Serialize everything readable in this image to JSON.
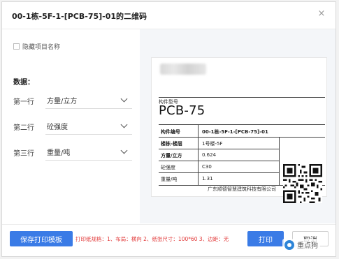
{
  "dialog": {
    "title": "00-1栋-5F-1-[PCB-75]-01的二维码",
    "close_icon": "×"
  },
  "options": {
    "hide_name_label": "隐藏项目名称",
    "hide_name_checked": false
  },
  "data_section": {
    "label": "数据：",
    "rows": [
      {
        "label": "第一行",
        "value": "方量/立方"
      },
      {
        "label": "第二行",
        "value": "砼强度"
      },
      {
        "label": "第三行",
        "value": "重量/吨"
      }
    ]
  },
  "preview": {
    "caption": "构件型号",
    "model": "PCB-75",
    "table": [
      {
        "key": "构件编号",
        "value": "00-1栋-5F-1-[PCB-75]-01"
      },
      {
        "key": "楼栋-楼层",
        "value": "1号楼-5F"
      },
      {
        "key": "方量/立方",
        "value": "0.624"
      },
      {
        "key": "砼强度",
        "value": "C30"
      },
      {
        "key": "重量/吨",
        "value": "1.31"
      }
    ],
    "company": "广东顺德智慧建筑科技有限公司"
  },
  "footer": {
    "save_template_label": "保存打印模板",
    "hint": "打印纸规格：1、布局：横向  2、纸张尺寸：100*60  3、边距：无",
    "print_label": "打印",
    "cancel_label": "取消"
  },
  "watermark": {
    "text": "重点狗"
  },
  "colors": {
    "primary": "#3a7be6",
    "hint_red": "#e23b3b",
    "preview_bg": "#f4f6f9"
  }
}
